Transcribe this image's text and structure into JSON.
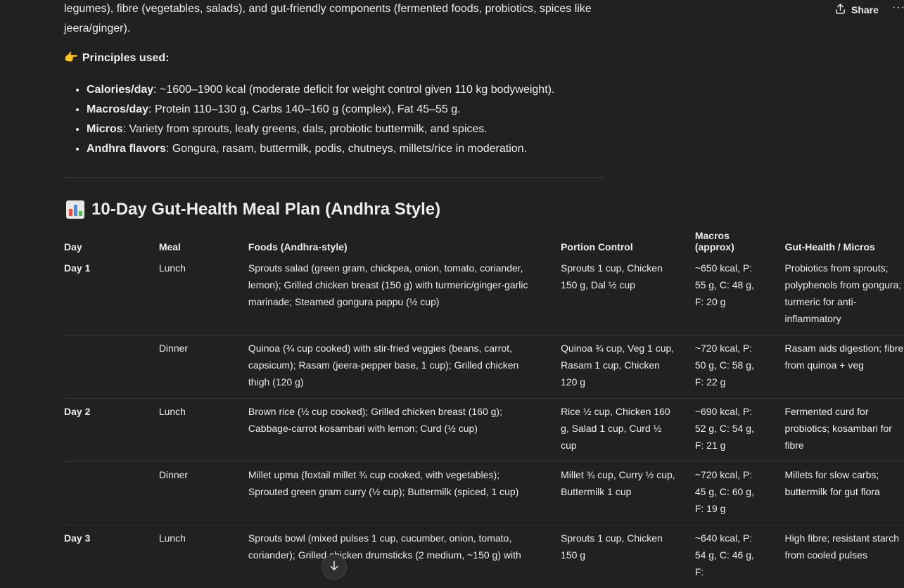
{
  "header": {
    "share_label": "Share",
    "more_label": "···"
  },
  "intro": {
    "text": "legumes), fibre (vegetables, salads), and gut-friendly components (fermented foods, probiotics, spices like jeera/ginger)."
  },
  "principles": {
    "emoji": "👉",
    "heading": "Principles used:",
    "items": [
      {
        "label": "Calories/day",
        "text": ": ~1600–1900 kcal (moderate deficit for weight control given 110 kg bodyweight)."
      },
      {
        "label": "Macros/day",
        "text": ": Protein 110–130 g, Carbs 140–160 g (complex), Fat 45–55 g."
      },
      {
        "label": "Micros",
        "text": ": Variety from sprouts, leafy greens, dals, probiotic buttermilk, and spices."
      },
      {
        "label": "Andhra flavors",
        "text": ": Gongura, rasam, buttermilk, podis, chutneys, millets/rice in moderation."
      }
    ]
  },
  "plan": {
    "icon": "bar-chart-icon",
    "title": "10-Day Gut-Health Meal Plan (Andhra Style)",
    "columns": [
      "Day",
      "Meal",
      "Foods (Andhra-style)",
      "Portion Control",
      "Macros (approx)",
      "Gut-Health / Micros"
    ],
    "rows": [
      {
        "day": "Day 1",
        "meal": "Lunch",
        "foods": "Sprouts salad (green gram, chickpea, onion, tomato, coriander, lemon); Grilled chicken breast (150 g) with turmeric/ginger-garlic marinade; Steamed gongura pappu (½ cup)",
        "portion": "Sprouts 1 cup, Chicken 150 g, Dal ½ cup",
        "macros": "~650 kcal, P: 55 g, C: 48 g, F: 20 g",
        "gut": "Probiotics from sprouts; polyphenols from gongura; turmeric for anti-inflammatory"
      },
      {
        "day": "",
        "meal": "Dinner",
        "foods": "Quinoa (¾ cup cooked) with stir-fried veggies (beans, carrot, capsicum); Rasam (jeera-pepper base, 1 cup); Grilled chicken thigh (120 g)",
        "portion": "Quinoa ¾ cup, Veg 1 cup, Rasam 1 cup, Chicken 120 g",
        "macros": "~720 kcal, P: 50 g, C: 58 g, F: 22 g",
        "gut": "Rasam aids digestion; fibre from quinoa + veg"
      },
      {
        "day": "Day 2",
        "meal": "Lunch",
        "foods": "Brown rice (½ cup cooked); Grilled chicken breast (160 g); Cabbage-carrot kosambari with lemon; Curd (½ cup)",
        "portion": "Rice ½ cup, Chicken 160 g, Salad 1 cup, Curd ½ cup",
        "macros": "~690 kcal, P: 52 g, C: 54 g, F: 21 g",
        "gut": "Fermented curd for probiotics; kosambari for fibre"
      },
      {
        "day": "",
        "meal": "Dinner",
        "foods": "Millet upma (foxtail millet ¾ cup cooked, with vegetables); Sprouted green gram curry (½ cup); Buttermilk (spiced, 1 cup)",
        "portion": "Millet ¾ cup, Curry ½ cup, Buttermilk 1 cup",
        "macros": "~720 kcal, P: 45 g, C: 60 g, F: 19 g",
        "gut": "Millets for slow carbs; buttermilk for gut flora"
      },
      {
        "day": "Day 3",
        "meal": "Lunch",
        "foods": "Sprouts bowl (mixed pulses 1 cup, cucumber, onion, tomato, coriander); Grilled chicken drumsticks (2 medium, ~150 g) with",
        "portion": "Sprouts 1 cup, Chicken 150 g",
        "macros": "~640 kcal, P: 54 g, C: 46 g, F:",
        "gut": "High fibre; resistant starch from cooled pulses"
      }
    ]
  }
}
